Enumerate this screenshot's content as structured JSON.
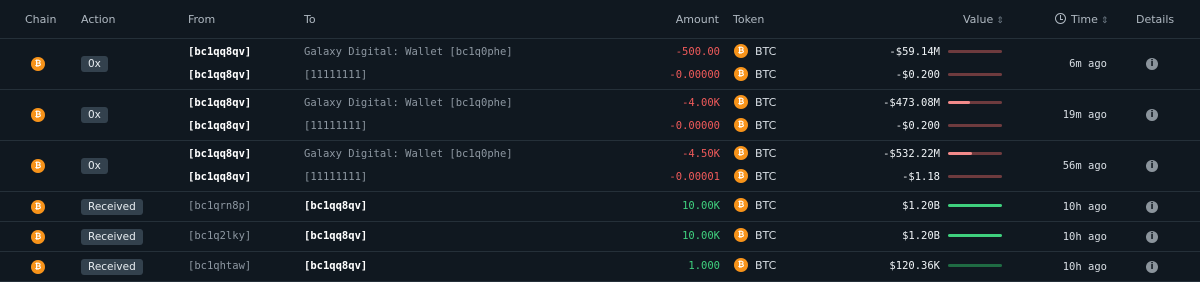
{
  "header": {
    "chain": "Chain",
    "action": "Action",
    "from": "From",
    "to": "To",
    "amount": "Amount",
    "token": "Token",
    "value": "Value",
    "time": "Time",
    "details": "Details"
  },
  "icons": {
    "chain": "bitcoin-icon",
    "token": "bitcoin-icon",
    "details": "info-icon",
    "sort": "sort-arrows-icon",
    "time": "clock-icon"
  },
  "colors": {
    "background": "#101820",
    "negative": "#ef5a5a",
    "positive": "#3fd07e",
    "bitcoin": "#f7931a",
    "badge": "#33414d"
  },
  "rows": [
    {
      "action": "0x",
      "time": "6m ago",
      "transfers": [
        {
          "from": "[bc1qq8qv]",
          "to": "Galaxy Digital: Wallet [bc1q0phe]",
          "amount": "-500.00",
          "token": "BTC",
          "value": "-$59.14M",
          "bar_level": 0.0,
          "direction": "out"
        },
        {
          "from": "[bc1qq8qv]",
          "to": "[11111111]",
          "amount": "-0.00000",
          "token": "BTC",
          "value": "-$0.200",
          "bar_level": 0.0,
          "direction": "out"
        }
      ]
    },
    {
      "action": "0x",
      "time": "19m ago",
      "transfers": [
        {
          "from": "[bc1qq8qv]",
          "to": "Galaxy Digital: Wallet [bc1q0phe]",
          "amount": "-4.00K",
          "token": "BTC",
          "value": "-$473.08M",
          "bar_level": 0.4,
          "direction": "out"
        },
        {
          "from": "[bc1qq8qv]",
          "to": "[11111111]",
          "amount": "-0.00000",
          "token": "BTC",
          "value": "-$0.200",
          "bar_level": 0.0,
          "direction": "out"
        }
      ]
    },
    {
      "action": "0x",
      "time": "56m ago",
      "transfers": [
        {
          "from": "[bc1qq8qv]",
          "to": "Galaxy Digital: Wallet [bc1q0phe]",
          "amount": "-4.50K",
          "token": "BTC",
          "value": "-$532.22M",
          "bar_level": 0.45,
          "direction": "out"
        },
        {
          "from": "[bc1qq8qv]",
          "to": "[11111111]",
          "amount": "-0.00001",
          "token": "BTC",
          "value": "-$1.18",
          "bar_level": 0.0,
          "direction": "out"
        }
      ]
    },
    {
      "action": "Received",
      "time": "10h ago",
      "transfers": [
        {
          "from": "[bc1qrn8p]",
          "to": "[bc1qq8qv]",
          "amount": "10.00K",
          "token": "BTC",
          "value": "$1.20B",
          "bar_level": 1.0,
          "direction": "in"
        }
      ]
    },
    {
      "action": "Received",
      "time": "10h ago",
      "transfers": [
        {
          "from": "[bc1q2lky]",
          "to": "[bc1qq8qv]",
          "amount": "10.00K",
          "token": "BTC",
          "value": "$1.20B",
          "bar_level": 1.0,
          "direction": "in"
        }
      ]
    },
    {
      "action": "Received",
      "time": "10h ago",
      "transfers": [
        {
          "from": "[bc1qhtaw]",
          "to": "[bc1qq8qv]",
          "amount": "1.000",
          "token": "BTC",
          "value": "$120.36K",
          "bar_level": 0.0,
          "direction": "in"
        }
      ]
    }
  ]
}
